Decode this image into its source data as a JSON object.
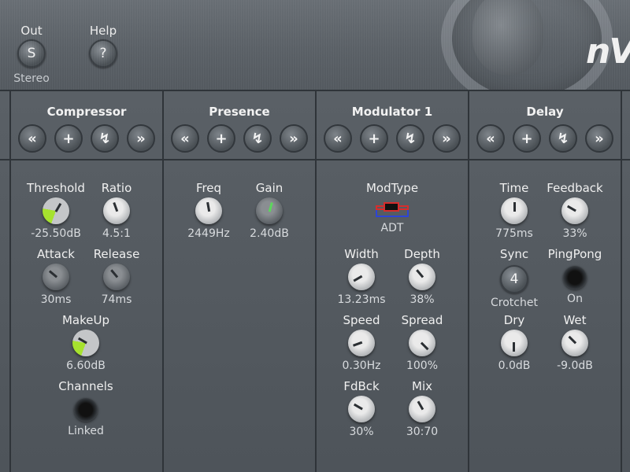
{
  "header": {
    "out": {
      "label": "Out",
      "button": "S",
      "value": "Stereo"
    },
    "help": {
      "label": "Help",
      "button": "?"
    },
    "logo": "nV"
  },
  "panels": {
    "compressor": {
      "title": "Compressor",
      "threshold": {
        "label": "Threshold",
        "value": "-25.50dB"
      },
      "ratio": {
        "label": "Ratio",
        "value": "4.5:1"
      },
      "attack": {
        "label": "Attack",
        "value": "30ms"
      },
      "release": {
        "label": "Release",
        "value": "74ms"
      },
      "makeup": {
        "label": "MakeUp",
        "value": "6.60dB"
      },
      "channels": {
        "label": "Channels",
        "value": "Linked"
      }
    },
    "presence": {
      "title": "Presence",
      "freq": {
        "label": "Freq",
        "value": "2449Hz"
      },
      "gain": {
        "label": "Gain",
        "value": "2.40dB"
      }
    },
    "modulator": {
      "title": "Modulator 1",
      "modtype": {
        "label": "ModType",
        "value": "ADT"
      },
      "width": {
        "label": "Width",
        "value": "13.23ms"
      },
      "depth": {
        "label": "Depth",
        "value": "38%"
      },
      "speed": {
        "label": "Speed",
        "value": "0.30Hz"
      },
      "spread": {
        "label": "Spread",
        "value": "100%"
      },
      "fdbck": {
        "label": "FdBck",
        "value": "30%"
      },
      "mix": {
        "label": "Mix",
        "value": "30:70"
      }
    },
    "delay": {
      "title": "Delay",
      "time": {
        "label": "Time",
        "value": "775ms"
      },
      "feedback": {
        "label": "Feedback",
        "value": "33%"
      },
      "sync": {
        "label": "Sync",
        "button": "4",
        "value": "Crotchet"
      },
      "pingpong": {
        "label": "PingPong",
        "value": "On"
      },
      "dry": {
        "label": "Dry",
        "value": "0.0dB"
      },
      "wet": {
        "label": "Wet",
        "value": "-9.0dB"
      }
    }
  },
  "panel_buttons": {
    "prev": "«",
    "add": "+",
    "route": "↯",
    "next": "»"
  },
  "colors": {
    "accent_green": "#a6e22e",
    "bg": "#4f555b"
  }
}
